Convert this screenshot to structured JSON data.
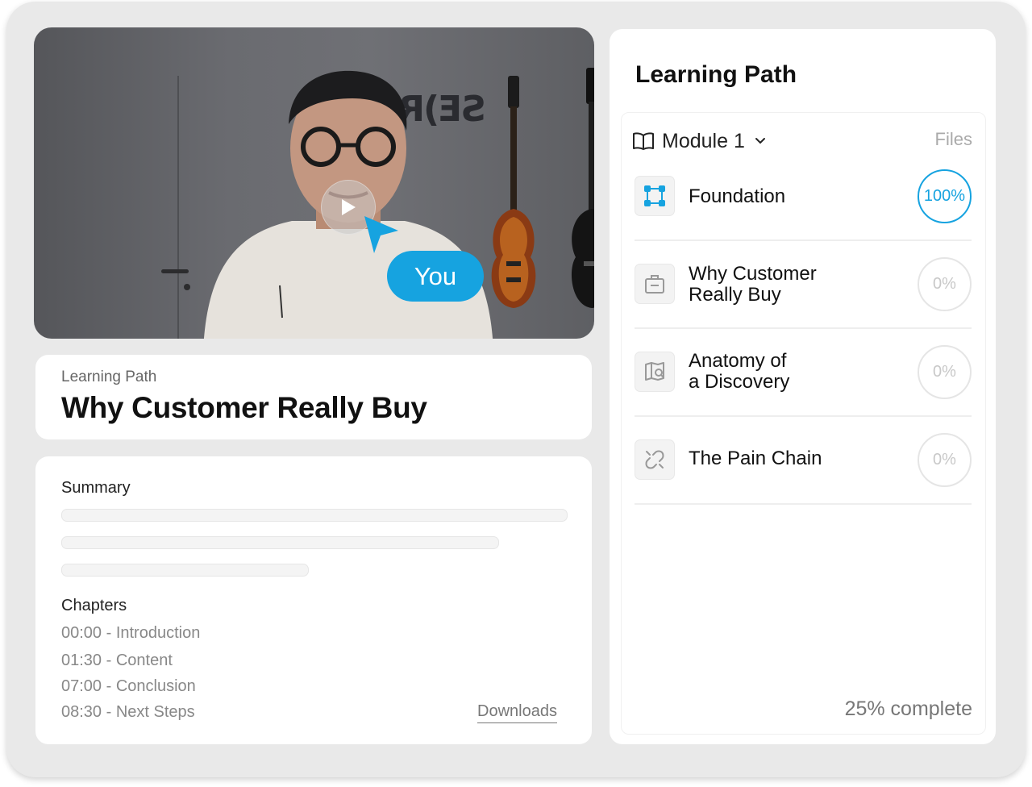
{
  "video": {
    "wall_logo_blue": "<",
    "wall_logo_text": "SE)ROS",
    "caller_label": "You",
    "accent_color": "#16a3e0"
  },
  "header": {
    "eyebrow": "Learning Path",
    "title": "Why Customer Really Buy"
  },
  "summary": {
    "label": "Summary",
    "chapters_label": "Chapters",
    "chapters": [
      "00:00 - Introduction",
      "01:30 - Content",
      "07:00 - Conclusion",
      "08:30 - Next Steps"
    ],
    "downloads_label": "Downloads"
  },
  "learning_path": {
    "title": "Learning Path",
    "module_label": "Module 1",
    "files_label": "Files",
    "lessons": [
      {
        "title": "Foundation",
        "progress": "100%",
        "icon": "bounding-box-icon"
      },
      {
        "title": "Why Customer Really Buy",
        "line1": "Why Customer",
        "line2": "Really Buy",
        "progress": "0%",
        "icon": "briefcase-icon"
      },
      {
        "title": "Anatomy of a Discovery",
        "line1": "Anatomy of",
        "line2": "a Discovery",
        "progress": "0%",
        "icon": "map-search-icon"
      },
      {
        "title": "The Pain Chain",
        "progress": "0%",
        "icon": "broken-link-icon"
      }
    ],
    "complete_text": "25% complete"
  }
}
